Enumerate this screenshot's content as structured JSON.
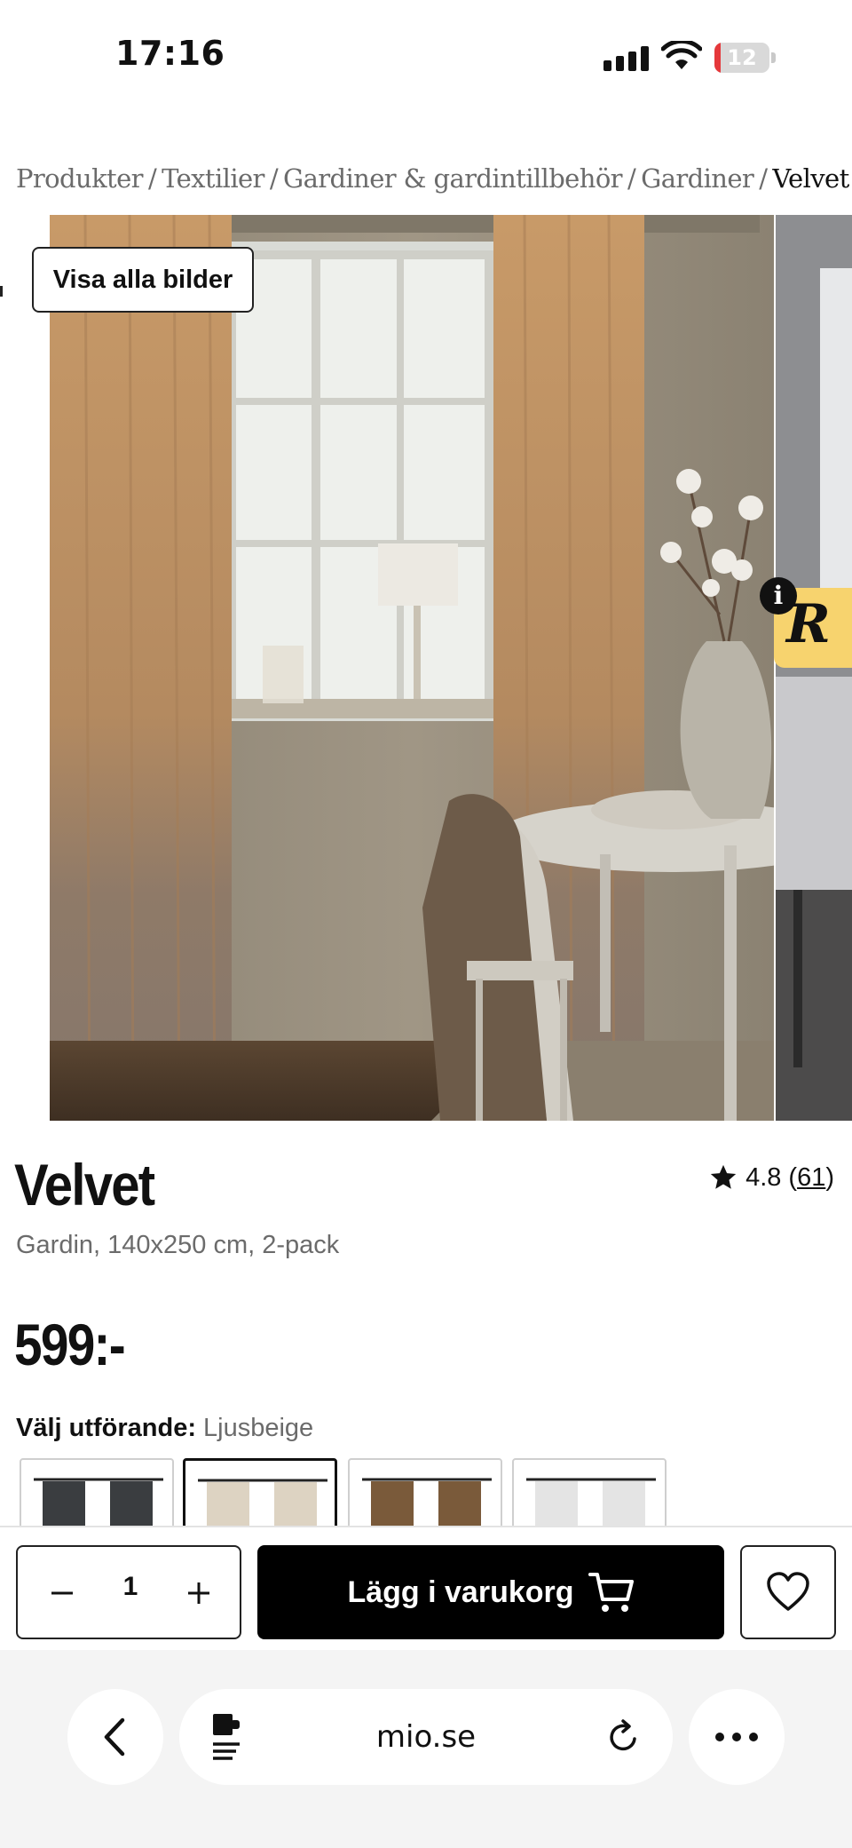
{
  "status_bar": {
    "time": "17:16",
    "battery": "12",
    "battery_level_percent": 12
  },
  "breadcrumb": {
    "items": [
      "Produkter",
      "Textilier",
      "Gardiner & gardintillbehör",
      "Gardiner"
    ],
    "current": "Velvet",
    "separator": "/"
  },
  "gallery": {
    "view_all_label": "Visa alla bilder"
  },
  "product": {
    "title": "Velvet",
    "rating": "4.8",
    "review_count": "61",
    "subtitle": "Gardin, 140x250 cm, 2-pack",
    "price": "599:-"
  },
  "variant": {
    "label": "Välj utförande:",
    "selected": "Ljusbeige",
    "swatch_colors": [
      "#3a3d40",
      "#ddd3c2",
      "#7a5a3a",
      "#e4e4e4"
    ]
  },
  "cart": {
    "quantity": "1",
    "add_label": "Lägg i varukorg"
  },
  "browser": {
    "url": "mio.se"
  },
  "colors": {
    "accent": "#000000",
    "badge": "#f7d36e",
    "battery": "#e5383b"
  }
}
